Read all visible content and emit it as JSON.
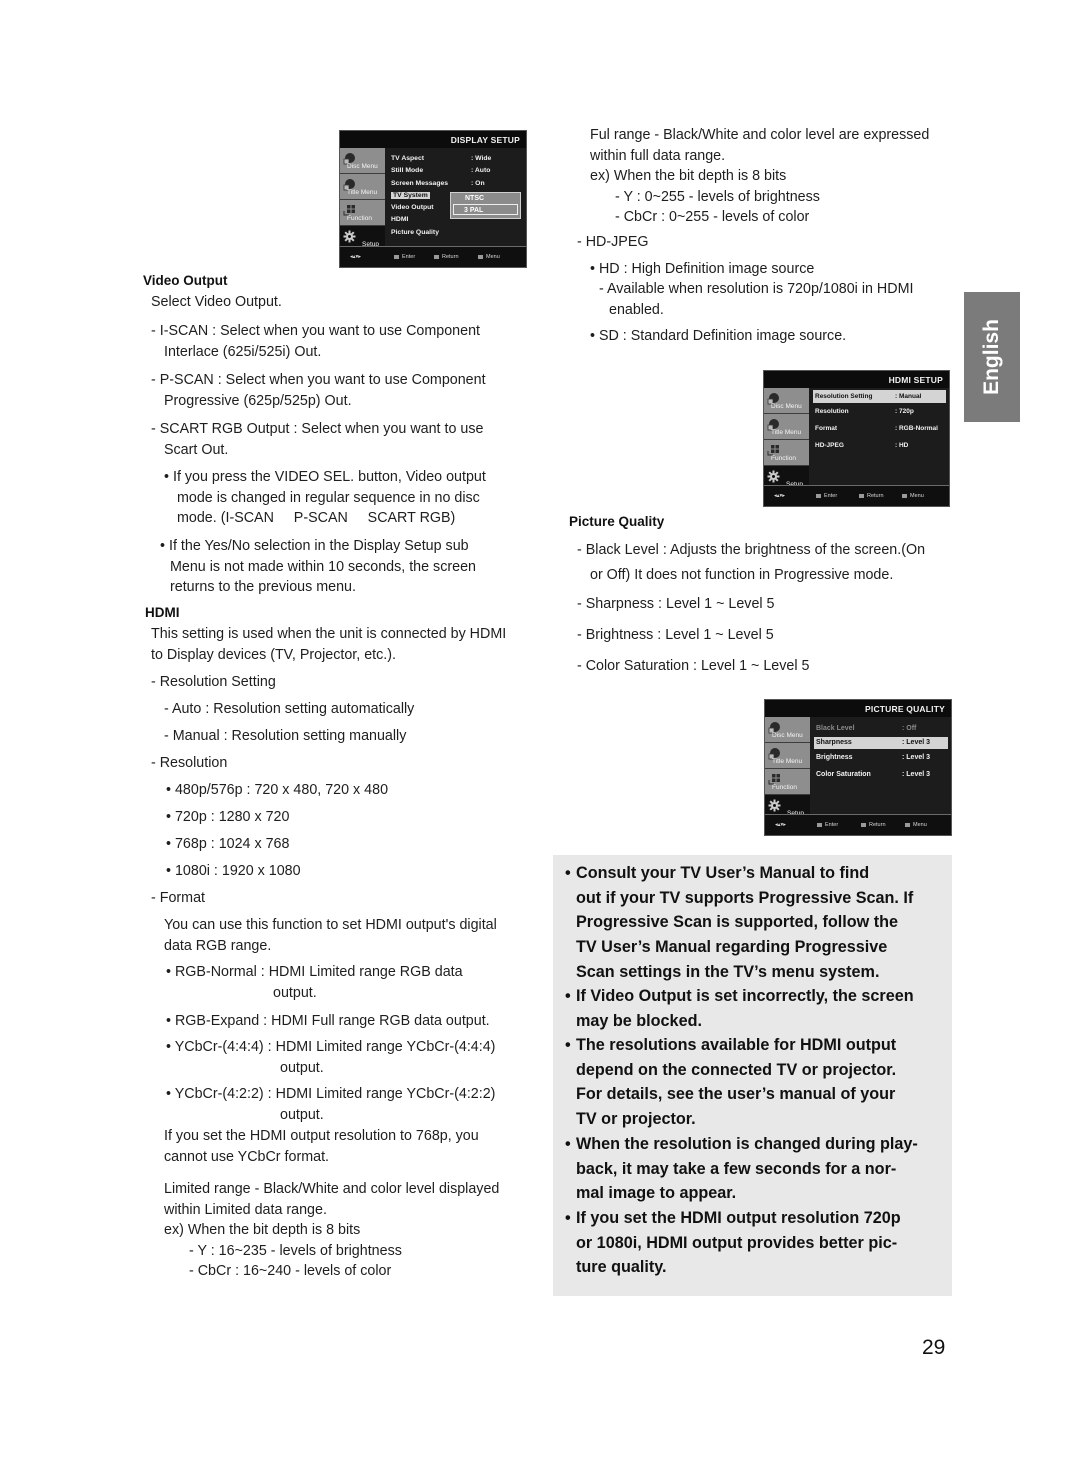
{
  "page_number": "29",
  "language_tab": "English",
  "display_setup_menu": {
    "title": "DISPLAY SETUP",
    "sidebar": [
      "Disc Menu",
      "Title Menu",
      "Function",
      "Setup"
    ],
    "rows": [
      {
        "label": "TV Aspect",
        "value": ": Wide"
      },
      {
        "label": "Still Mode",
        "value": ": Auto"
      },
      {
        "label": "Screen Messages",
        "value": ": On"
      },
      {
        "label": "TV System",
        "value": ""
      },
      {
        "label": "Video Output",
        "value": ""
      },
      {
        "label": "HDMI",
        "value": ""
      },
      {
        "label": "Picture Quality",
        "value": ""
      }
    ],
    "popup_options": [
      "NTSC",
      "3 PAL"
    ],
    "footer": {
      "enter": "Enter",
      "return": "Return",
      "menu": "Menu"
    }
  },
  "hdmi_setup_menu": {
    "title": "HDMI SETUP",
    "sidebar": [
      "Disc Menu",
      "Title Menu",
      "Function",
      "Setup"
    ],
    "rows": [
      {
        "label": "Resolution Setting",
        "value": ": Manual"
      },
      {
        "label": "Resolution",
        "value": ": 720p"
      },
      {
        "label": "Format",
        "value": ": RGB-Normal"
      },
      {
        "label": "HD-JPEG",
        "value": ": HD"
      }
    ],
    "footer": {
      "enter": "Enter",
      "return": "Return",
      "menu": "Menu"
    }
  },
  "picture_quality_menu": {
    "title": "PICTURE QUALITY",
    "sidebar": [
      "Disc Menu",
      "Title Menu",
      "Function",
      "Setup"
    ],
    "rows": [
      {
        "label": "Black Level",
        "value": ": Off"
      },
      {
        "label": "Sharpness",
        "value": ": Level 3"
      },
      {
        "label": "Brightness",
        "value": ": Level 3"
      },
      {
        "label": "Color Saturation",
        "value": ": Level 3"
      }
    ],
    "footer": {
      "enter": "Enter",
      "return": "Return",
      "menu": "Menu"
    }
  },
  "video_output": {
    "heading": "Video Output",
    "intro": "Select Video Output.",
    "iscan": [
      "- I-SCAN : Select when you want to use Component",
      "Interlace (625i/525i) Out."
    ],
    "pscan": [
      "- P-SCAN : Select when you want to use Component",
      "Progressive (625p/525p) Out."
    ],
    "scart": [
      "- SCART RGB Output : Select when you want to use",
      "Scart Out."
    ],
    "bullet1": [
      "• If you press the VIDEO SEL. button, Video output",
      "mode is changed in regular sequence in no disc",
      "mode. (I-SCAN     P-SCAN     SCART RGB)"
    ],
    "bullet2": [
      "• If the Yes/No selection in the Display Setup sub",
      "Menu is not made within 10 seconds, the screen",
      "returns to the previous menu."
    ]
  },
  "hdmi": {
    "heading": "HDMI",
    "intro": [
      "This setting is used when the unit is connected by HDMI",
      "to Display devices (TV, Projector, etc.)."
    ],
    "resolution_setting": "- Resolution Setting",
    "auto": "- Auto : Resolution setting automatically",
    "manual": "- Manual : Resolution setting manually",
    "resolution": "- Resolution",
    "resolutions": [
      "• 480p/576p : 720 x 480, 720 x 480",
      "• 720p : 1280 x 720",
      "• 768p : 1024 x 768",
      "• 1080i : 1920 x 1080"
    ],
    "format": "- Format",
    "format_desc": [
      "You can use this function to set HDMI output's digital",
      "data RGB range."
    ],
    "formats": [
      [
        "• RGB-Normal : HDMI Limited range RGB data",
        "output."
      ],
      [
        "• RGB-Expand : HDMI Full range RGB data output."
      ],
      [
        "• YCbCr-(4:4:4) : HDMI Limited range YCbCr-(4:4:4)",
        "output."
      ],
      [
        "• YCbCr-(4:2:2) : HDMI Limited range YCbCr-(4:2:2)",
        "output."
      ]
    ],
    "ycbcr_note": [
      "If you set the HDMI output resolution to 768p, you",
      "cannot use YCbCr format."
    ],
    "limited": [
      "Limited range - Black/White and color level displayed",
      "within Limited data range.",
      "ex) When the bit depth is 8 bits",
      "- Y : 16~235 - levels of brightness",
      "- CbCr : 16~240 - levels of color"
    ],
    "full": [
      "Ful range - Black/White and color level are expressed",
      "within full data range.",
      "ex) When the bit depth is 8 bits",
      "- Y : 0~255 - levels of brightness",
      "- CbCr : 0~255 - levels of color"
    ],
    "hd_jpeg": "- HD-JPEG",
    "hd": "• HD : High Definition image source",
    "hd_avail": [
      "- Available when resolution is 720p/1080i in HDMI",
      "enabled."
    ],
    "sd": "• SD : Standard Definition image source."
  },
  "picture_quality": {
    "heading": "Picture Quality",
    "black_level": [
      "- Black Level : Adjusts the brightness of the screen.(On",
      "or Off) It does not function in Progressive mode."
    ],
    "sharpness": "- Sharpness : Level 1 ~ Level 5",
    "brightness": "- Brightness : Level 1 ~ Level 5",
    "color_saturation": "- Color Saturation : Level 1 ~ Level 5"
  },
  "notes": [
    [
      "Consult your TV User’s Manual to find",
      "out if your TV supports Progressive Scan. If",
      "Progressive Scan is supported, follow the",
      "TV User’s Manual regarding Progressive",
      "Scan settings in the TV’s menu system."
    ],
    [
      "If Video Output is set incorrectly, the screen",
      "may be blocked."
    ],
    [
      "The resolutions available for HDMI output",
      "depend on the connected TV or projector.",
      "For details, see the user’s manual of your",
      "TV or projector."
    ],
    [
      "When the resolution is changed during play-",
      "back, it may take a few seconds for a nor-",
      "mal image to appear."
    ],
    [
      "If you set the HDMI output resolution 720p",
      "or 1080i, HDMI output provides better pic-",
      "ture quality."
    ]
  ],
  "note_bullet": "•"
}
